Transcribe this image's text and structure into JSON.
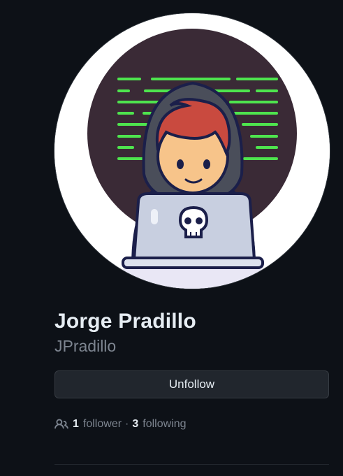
{
  "profile": {
    "full_name": "Jorge Pradillo",
    "username": "JPradillo",
    "avatar_alt": "Jorge Pradillo avatar"
  },
  "actions": {
    "unfollow_label": "Unfollow"
  },
  "stats": {
    "followers_count": "1",
    "followers_label": "follower",
    "separator": "·",
    "following_count": "3",
    "following_label": "following"
  },
  "icons": {
    "people": "people-icon",
    "skull": "skull-icon"
  },
  "colors": {
    "background": "#0d1117",
    "text_primary": "#e6edf3",
    "text_muted": "#7d8590",
    "button_bg": "#21262d",
    "code_green": "#4ee44e"
  }
}
